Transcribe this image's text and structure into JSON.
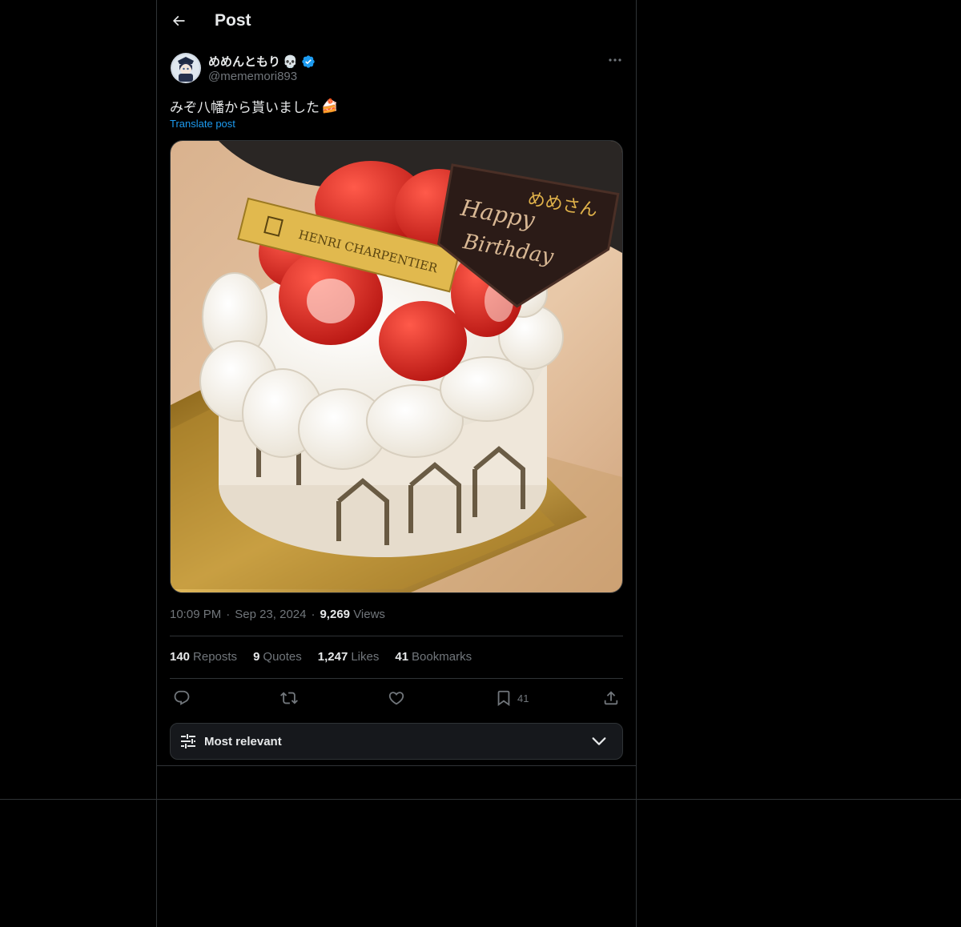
{
  "header": {
    "title": "Post",
    "back_icon": "back-arrow-icon"
  },
  "author": {
    "display_name": "めめんともり",
    "name_emoji": "💀",
    "handle": "@mememori893",
    "verified": true,
    "badge_color": "#1d9bf0"
  },
  "post": {
    "text": "みぞ八幡から貰いました",
    "text_emoji": "🍰",
    "translate_label": "Translate post",
    "image": {
      "brand_plaque": "HENRI CHARPENTIER",
      "chocolate_plate_line1": "Happy",
      "chocolate_plate_line2": "Birthday",
      "chocolate_plate_name": "めめさん"
    }
  },
  "meta": {
    "time": "10:09 PM",
    "separator": "·",
    "date": "Sep 23, 2024",
    "views_count": "9,269",
    "views_label": "Views"
  },
  "stats": {
    "reposts_count": "140",
    "reposts_label": "Reposts",
    "quotes_count": "9",
    "quotes_label": "Quotes",
    "likes_count": "1,247",
    "likes_label": "Likes",
    "bookmarks_count": "41",
    "bookmarks_label": "Bookmarks"
  },
  "actions": {
    "reply_icon": "reply-icon",
    "repost_icon": "repost-icon",
    "like_icon": "heart-icon",
    "bookmark_icon": "bookmark-icon",
    "bookmark_count": "41",
    "share_icon": "share-icon"
  },
  "replies_sort": {
    "label": "Most relevant",
    "icon": "sliders-icon",
    "dropdown_icon": "chevron-down-icon"
  },
  "colors": {
    "background": "#000000",
    "border": "#2f3336",
    "accent": "#1d9bf0",
    "muted": "#71767b",
    "text": "#e7e9ea"
  }
}
